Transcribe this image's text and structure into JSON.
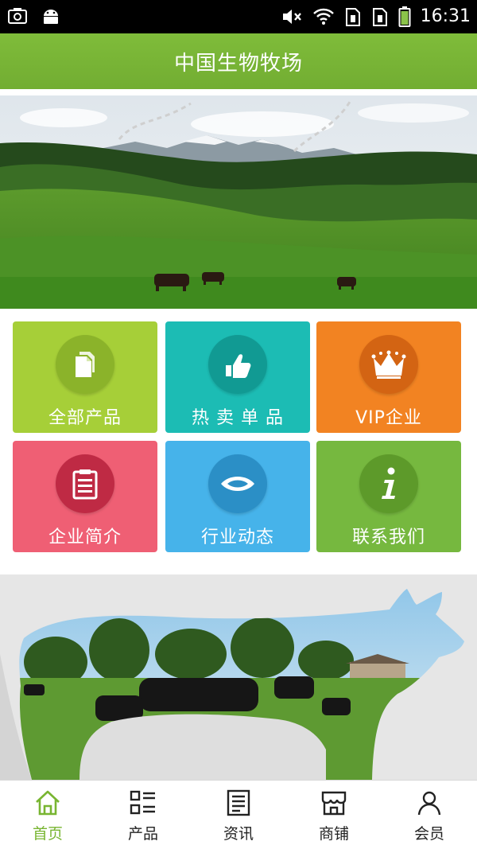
{
  "status_bar": {
    "time": "16:31",
    "icons": [
      "screenshot-icon",
      "android-icon",
      "mute-icon",
      "wifi-icon",
      "sim1-icon",
      "sim2-icon",
      "battery-icon"
    ]
  },
  "header": {
    "title": "中国生物牧场"
  },
  "colors": {
    "brand_green": "#7cb342",
    "tile_products": "#a6cf38",
    "tile_hot": "#1cbcb4",
    "tile_vip": "#f28322",
    "tile_about": "#ef5f74",
    "tile_news": "#46b3ea",
    "tile_contact": "#76b83f"
  },
  "tiles": [
    {
      "label": "全部产品",
      "icon": "documents-icon"
    },
    {
      "label": "热 卖 单 品",
      "icon": "thumbs-up-icon"
    },
    {
      "label": "VIP企业",
      "icon": "crown-icon"
    },
    {
      "label": "企业简介",
      "icon": "clipboard-icon"
    },
    {
      "label": "行业动态",
      "icon": "eye-icon"
    },
    {
      "label": "联系我们",
      "icon": "info-icon"
    }
  ],
  "tabbar": {
    "items": [
      {
        "label": "首页",
        "icon": "home-icon",
        "active": true
      },
      {
        "label": "产品",
        "icon": "grid-list-icon",
        "active": false
      },
      {
        "label": "资讯",
        "icon": "news-icon",
        "active": false
      },
      {
        "label": "商铺",
        "icon": "shop-icon",
        "active": false
      },
      {
        "label": "会员",
        "icon": "user-icon",
        "active": false
      }
    ]
  }
}
